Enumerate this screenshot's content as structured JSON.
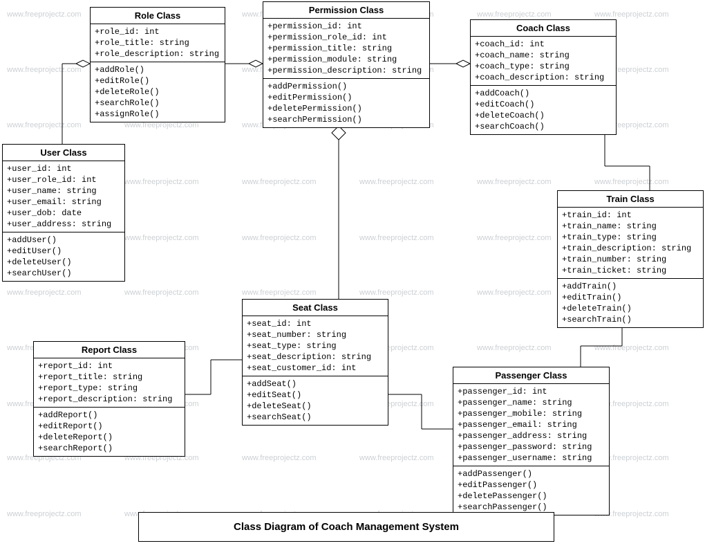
{
  "chart_data": {
    "type": "uml_class_diagram",
    "title": "Class Diagram of Coach Management System",
    "relationships": [
      {
        "from": "User Class",
        "to": "Role Class",
        "type": "aggregation",
        "diamond_at": "Role Class"
      },
      {
        "from": "Role Class",
        "to": "Permission Class",
        "type": "aggregation",
        "diamond_at": "Permission Class"
      },
      {
        "from": "Permission Class",
        "to": "Coach Class",
        "type": "aggregation",
        "diamond_at": "Coach Class"
      },
      {
        "from": "Permission Class",
        "to": "Seat Class",
        "type": "aggregation",
        "diamond_at": "Permission Class"
      },
      {
        "from": "Report Class",
        "to": "Seat Class",
        "type": "association"
      },
      {
        "from": "Seat Class",
        "to": "Passenger Class",
        "type": "association"
      },
      {
        "from": "Coach Class",
        "to": "Train Class",
        "type": "association"
      },
      {
        "from": "Train Class",
        "to": "Passenger Class",
        "type": "association"
      }
    ]
  },
  "watermark_text": "www.freeprojectz.com",
  "caption": "Class Diagram of Coach Management System",
  "classes": {
    "role": {
      "title": "Role Class",
      "attrs": [
        "+role_id: int",
        "+role_title: string",
        "+role_description: string"
      ],
      "methods": [
        "+addRole()",
        "+editRole()",
        "+deleteRole()",
        "+searchRole()",
        "+assignRole()"
      ]
    },
    "permission": {
      "title": "Permission Class",
      "attrs": [
        "+permission_id: int",
        "+permission_role_id: int",
        "+permission_title: string",
        "+permission_module: string",
        "+permission_description: string"
      ],
      "methods": [
        "+addPermission()",
        "+editPermission()",
        "+deletePermission()",
        "+searchPermission()"
      ]
    },
    "coach": {
      "title": "Coach Class",
      "attrs": [
        "+coach_id: int",
        "+coach_name: string",
        "+coach_type: string",
        "+coach_description: string"
      ],
      "methods": [
        "+addCoach()",
        "+editCoach()",
        "+deleteCoach()",
        "+searchCoach()"
      ]
    },
    "user": {
      "title": "User Class",
      "attrs": [
        "+user_id: int",
        "+user_role_id: int",
        "+user_name: string",
        "+user_email: string",
        "+user_dob: date",
        "+user_address: string"
      ],
      "methods": [
        "+addUser()",
        "+editUser()",
        "+deleteUser()",
        "+searchUser()"
      ]
    },
    "train": {
      "title": "Train Class",
      "attrs": [
        "+train_id: int",
        "+train_name: string",
        "+train_type: string",
        "+train_description: string",
        "+train_number: string",
        "+train_ticket: string"
      ],
      "methods": [
        "+addTrain()",
        "+editTrain()",
        "+deleteTrain()",
        "+searchTrain()"
      ]
    },
    "seat": {
      "title": "Seat Class",
      "attrs": [
        "+seat_id: int",
        "+seat_number: string",
        "+seat_type: string",
        "+seat_description: string",
        "+seat_customer_id: int"
      ],
      "methods": [
        "+addSeat()",
        "+editSeat()",
        "+deleteSeat()",
        "+searchSeat()"
      ]
    },
    "report": {
      "title": "Report Class",
      "attrs": [
        "+report_id: int",
        "+report_title: string",
        "+report_type: string",
        "+report_description: string"
      ],
      "methods": [
        "+addReport()",
        "+editReport()",
        "+deleteReport()",
        "+searchReport()"
      ]
    },
    "passenger": {
      "title": "Passenger Class",
      "attrs": [
        "+passenger_id: int",
        "+passenger_name: string",
        "+passenger_mobile: string",
        "+passenger_email: string",
        "+passenger_address: string",
        "+passenger_password: string",
        "+passenger_username: string"
      ],
      "methods": [
        "+addPassenger()",
        "+editPassenger()",
        "+deletePassenger()",
        "+searchPassenger()"
      ]
    }
  }
}
